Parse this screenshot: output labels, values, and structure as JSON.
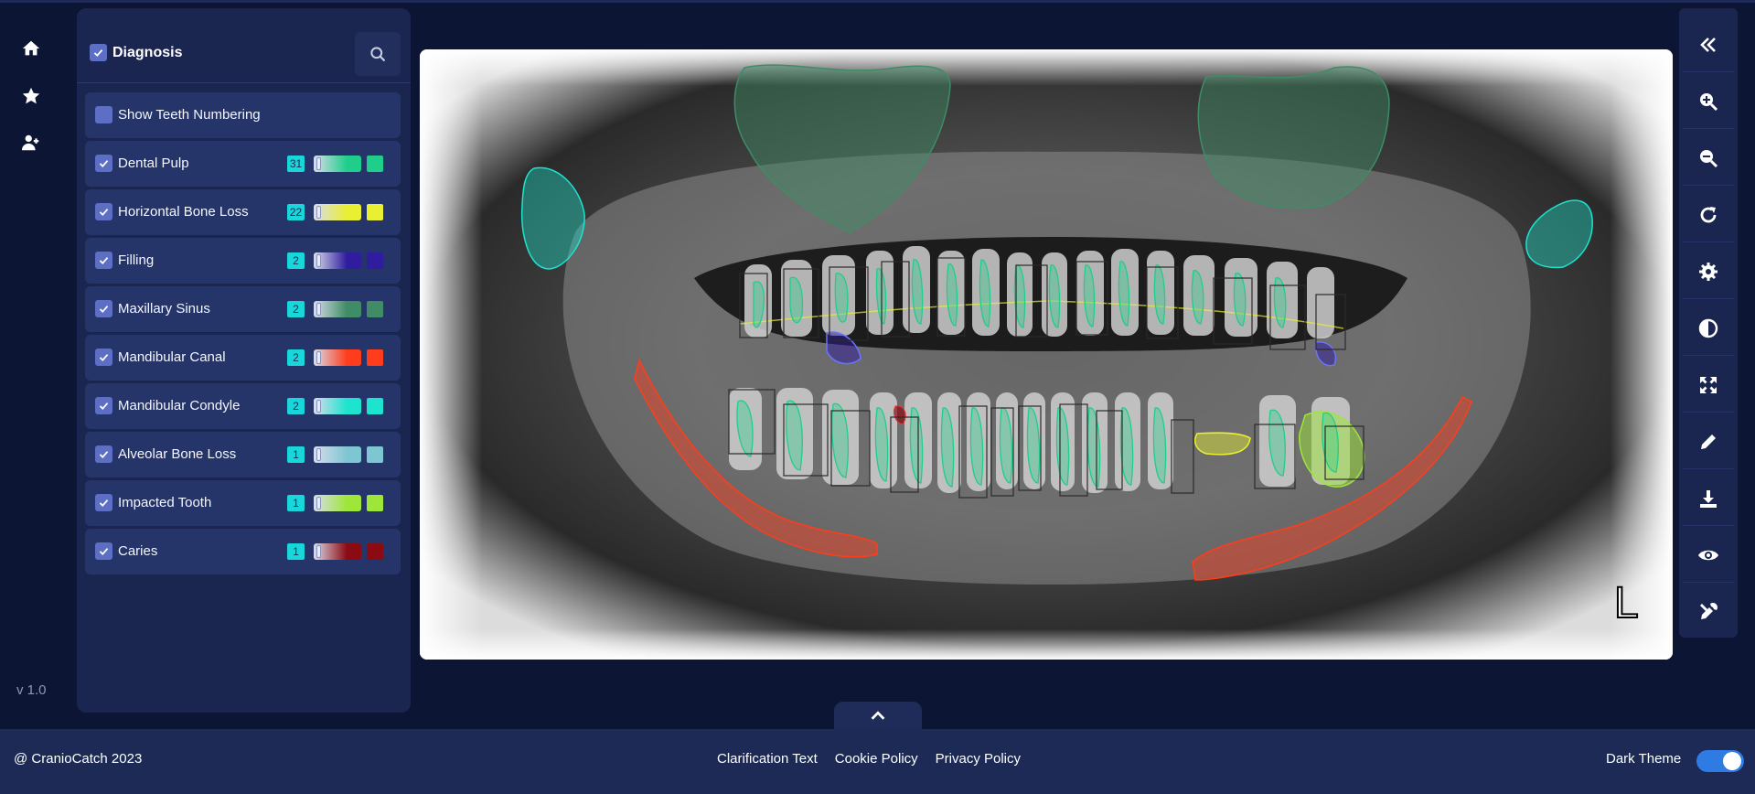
{
  "nav": {
    "items": [
      {
        "icon": "home-icon"
      },
      {
        "icon": "star-icon"
      },
      {
        "icon": "add-user-icon"
      }
    ],
    "version": "v 1.0"
  },
  "panel": {
    "title": "Diagnosis",
    "title_checked": true,
    "show_numbering": {
      "label": "Show Teeth Numbering",
      "checked": false
    },
    "items": [
      {
        "label": "Dental Pulp",
        "count": "31",
        "color": "#1fce8a",
        "checked": true
      },
      {
        "label": "Horizontal Bone Loss",
        "count": "22",
        "color": "#e9ef33",
        "checked": true
      },
      {
        "label": "Filling",
        "count": "2",
        "color": "#2f1c9e",
        "checked": true
      },
      {
        "label": "Maxillary Sinus",
        "count": "2",
        "color": "#3f8c66",
        "checked": true
      },
      {
        "label": "Mandibular Canal",
        "count": "2",
        "color": "#ff3d1c",
        "checked": true
      },
      {
        "label": "Mandibular Condyle",
        "count": "2",
        "color": "#1de3cf",
        "checked": true
      },
      {
        "label": "Alveolar Bone Loss",
        "count": "1",
        "color": "#7fc6d3",
        "checked": true
      },
      {
        "label": "Impacted Tooth",
        "count": "1",
        "color": "#9ee63a",
        "checked": true
      },
      {
        "label": "Caries",
        "count": "1",
        "color": "#8c0a12",
        "checked": true
      }
    ]
  },
  "xray": {
    "side_marker": "L"
  },
  "toolbar": {
    "tools": [
      "collapse-icon",
      "zoom-in-icon",
      "zoom-out-icon",
      "rotate-icon",
      "settings-icon",
      "contrast-icon",
      "fit-screen-icon",
      "edit-icon",
      "download-icon",
      "visibility-icon",
      "tools-icon"
    ]
  },
  "footer": {
    "copyright": "@ CranioCatch 2023",
    "links": [
      "Clarification Text",
      "Cookie Policy",
      "Privacy Policy"
    ],
    "theme_label": "Dark Theme",
    "dark_theme_on": true
  }
}
